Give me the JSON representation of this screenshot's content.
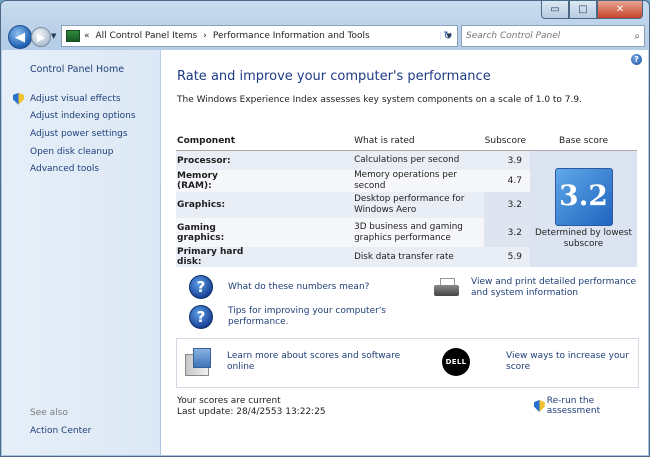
{
  "window": {
    "minimize_icon": "minimize-icon",
    "maximize_icon": "maximize-icon",
    "close_icon": "close-icon",
    "min_glyph": "▭",
    "max_glyph": "□",
    "close_glyph": "✕"
  },
  "nav": {
    "back_glyph": "◀",
    "forward_glyph": "▶",
    "history_glyph": "▼",
    "address_prefix": "«",
    "breadcrumb": [
      "All Control Panel Items",
      "Performance Information and Tools"
    ],
    "breadcrumb_sep": "›",
    "address_dropdown": "▼",
    "refresh_glyph": "↻",
    "search_placeholder": "Search Control Panel",
    "search_glyph": "⌕"
  },
  "sidebar": {
    "home": "Control Panel Home",
    "items": [
      {
        "label": "Adjust visual effects",
        "icon": "uac-shield-icon"
      },
      {
        "label": "Adjust indexing options",
        "icon": ""
      },
      {
        "label": "Adjust power settings",
        "icon": ""
      },
      {
        "label": "Open disk cleanup",
        "icon": ""
      },
      {
        "label": "Advanced tools",
        "icon": ""
      }
    ],
    "see_also": "See also",
    "action_center": "Action Center"
  },
  "main": {
    "help_glyph": "?",
    "title": "Rate and improve your computer's performance",
    "description": "The Windows Experience Index assesses key system components on a scale of 1.0 to 7.9.",
    "table": {
      "headers": {
        "component": "Component",
        "rated": "What is rated",
        "subscore": "Subscore",
        "base": "Base score"
      },
      "rows": [
        {
          "component": "Processor:",
          "rated": "Calculations per second",
          "score": "3.9"
        },
        {
          "component": "Memory (RAM):",
          "rated": "Memory operations per second",
          "score": "4.7"
        },
        {
          "component": "Graphics:",
          "rated": "Desktop performance for Windows Aero",
          "score": "3.2"
        },
        {
          "component": "Gaming graphics:",
          "rated": "3D business and gaming graphics performance",
          "score": "3.2"
        },
        {
          "component": "Primary hard disk:",
          "rated": "Disk data transfer rate",
          "score": "5.9"
        }
      ],
      "base_score": "3.2",
      "base_caption": "Determined by lowest subscore"
    },
    "tips": {
      "what_numbers": "What do these numbers mean?",
      "improving": "Tips for improving your computer's performance.",
      "print": "View and print detailed performance and system information",
      "learn_more": "Learn more about scores and software online",
      "increase": "View ways to increase your score",
      "dell_logo_text": "DELL"
    },
    "status": {
      "current": "Your scores are current",
      "last_update": "Last update: 28/4/2553 13:22:25",
      "rerun": "Re-run the assessment"
    }
  },
  "colors": {
    "link": "#1f3f78",
    "title": "#1d3b84",
    "sidebar_bg": "#dce8f5",
    "table_row": "#e9edf5",
    "base_cell": "#dce3f1"
  }
}
